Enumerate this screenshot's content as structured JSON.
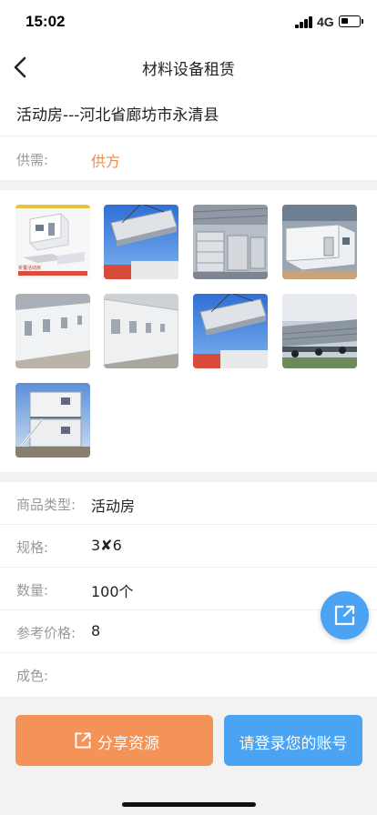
{
  "status_bar": {
    "time": "15:02",
    "network": "4G",
    "battery_level": 0.4
  },
  "nav": {
    "title": "材料设备租赁",
    "back_icon": "chevron-left-icon"
  },
  "listing": {
    "title": "活动房---河北省廊坊市永清县",
    "supply_label": "供需:",
    "supply_value": "供方"
  },
  "gallery": {
    "images": [
      {
        "subject": "folding container house product ad",
        "caption": "折叠活动房"
      },
      {
        "subject": "container house lifted by crane"
      },
      {
        "subject": "stacked container panels in warehouse"
      },
      {
        "subject": "assembled container house in warehouse"
      },
      {
        "subject": "container house corridor"
      },
      {
        "subject": "row of container houses"
      },
      {
        "subject": "container house lifted by crane"
      },
      {
        "subject": "container houses loaded on trucks"
      },
      {
        "subject": "two-storey container house with stairs"
      }
    ]
  },
  "details": [
    {
      "label": "商品类型:",
      "value": "活动房"
    },
    {
      "label": "规格:",
      "value": "3✘6"
    },
    {
      "label": "数量:",
      "value": "100个"
    },
    {
      "label": "参考价格:",
      "value": "8"
    },
    {
      "label": "成色:",
      "value": ""
    }
  ],
  "actions": {
    "share_label": "分享资源",
    "login_label": "请登录您的账号",
    "fab_icon": "share-icon"
  },
  "colors": {
    "accent_orange": "#f49358",
    "accent_blue": "#4aa3f3",
    "supply_orange": "#f08a4b"
  }
}
